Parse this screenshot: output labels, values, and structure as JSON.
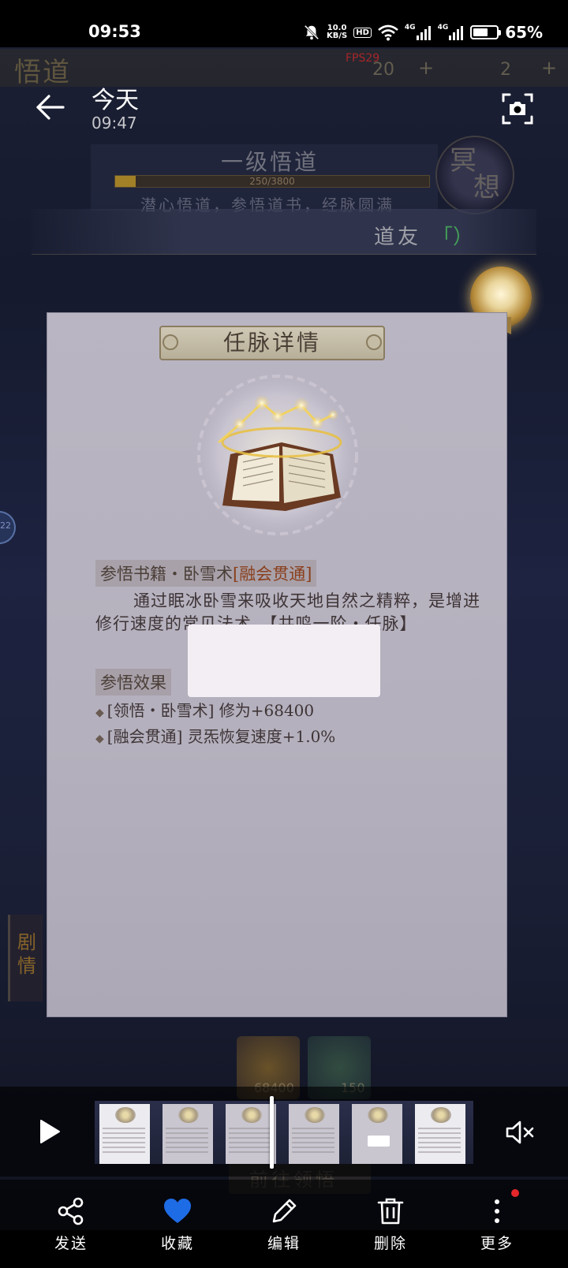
{
  "status_bar": {
    "time": "09:53",
    "network_speed_value": "10.0",
    "network_speed_unit": "KB/S",
    "hd_badge": "HD",
    "signal_1_label": "4G",
    "signal_2_label": "4G",
    "battery_text": "65%",
    "battery_level": 0.65
  },
  "viewer_header": {
    "title": "今天",
    "time": "09:47",
    "back_icon": "arrow-left-icon",
    "screenshot_icon": "screenshot-camera-icon"
  },
  "game_background": {
    "title": "悟道",
    "fps": "FPS29",
    "top_counter_1": "20",
    "top_counter_2": "2",
    "plus": "+",
    "level_title": "一级悟道",
    "progress_text": "250/3800",
    "progress_fraction": 0.066,
    "subtitle": "潜心悟道，参悟道书，经脉圆满",
    "meditate_label_1": "冥",
    "meditate_label_2": "想",
    "daoyou_label": "道友",
    "daoyou_value": "「）",
    "left_badge": "22",
    "side_banner": "剧情",
    "item_1_count": "68400",
    "item_2_count": "150",
    "ghost_button": "前往领悟"
  },
  "detail_card": {
    "title": "任脉详情",
    "book_label_prefix": "参悟书籍・卧雪术",
    "book_label_accent": "[融会贯通]",
    "description": "通过眠冰卧雪来吸收天地自然之精粹，是增进修行速度的常见法术。【共鸣一阶・任脉】",
    "effect_heading": "参悟效果",
    "effects": [
      "[领悟・卧雪术] 修为+68400",
      "[融会贯通] 灵炁恢复速度+1.0%"
    ]
  },
  "scrubber": {
    "play_icon": "play-icon",
    "mute_icon": "volume-muted-icon",
    "thumbnail_count": 6
  },
  "actions": {
    "send": "发送",
    "favorite": "收藏",
    "edit": "编辑",
    "delete": "删除",
    "more": "更多"
  },
  "colors": {
    "favorite_active": "#1e6be6",
    "notification_dot": "#e5262b",
    "accent_text": "#8a3f1c",
    "daoyou_green": "#46aa5a"
  }
}
